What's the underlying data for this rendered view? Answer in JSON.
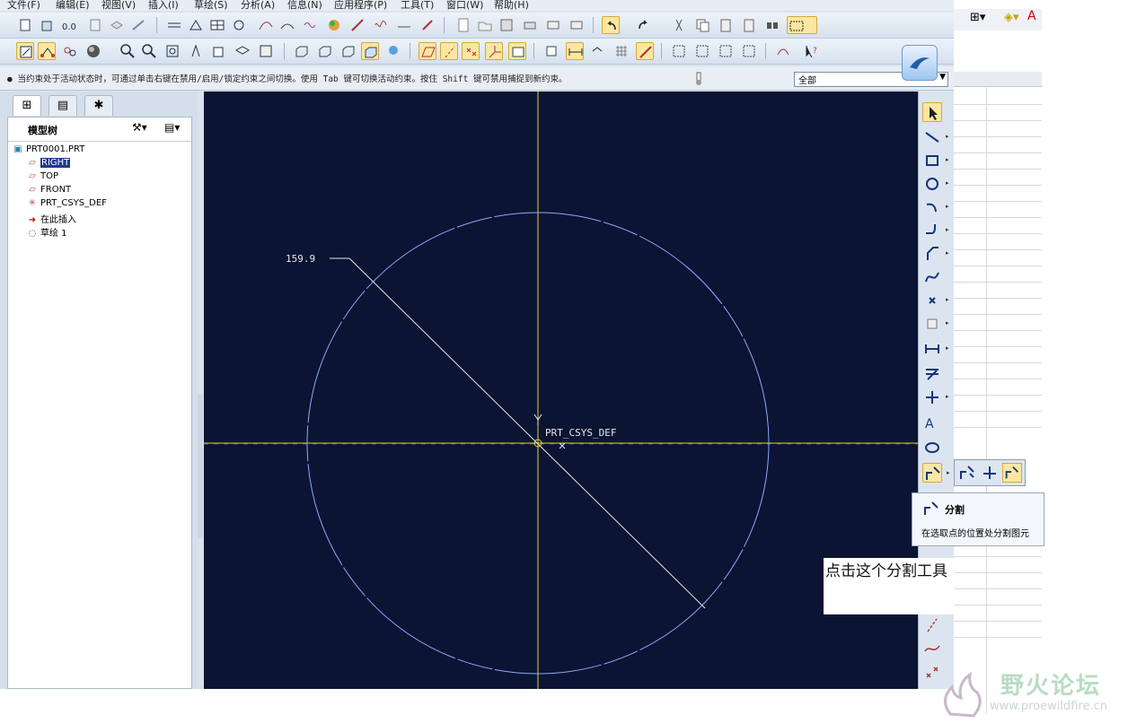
{
  "menu": [
    "文件(F)",
    "编辑(E)",
    "视图(V)",
    "插入(I)",
    "草绘(S)",
    "分析(A)",
    "信息(N)",
    "应用程序(P)",
    "工具(T)",
    "窗口(W)",
    "帮助(H)"
  ],
  "status_message": "● 当约束处于活动状态时，可通过单击右键在禁用/启用/锁定约束之间切换。使用 Tab 键可切换活动约束。按住 Shift 键可禁用捕捉到新约束。",
  "filter": {
    "value": "全部"
  },
  "model_tree": {
    "title": "模型树",
    "items": [
      {
        "label": "PRT0001.PRT",
        "icon": "part-icon"
      },
      {
        "label": "RIGHT",
        "icon": "datum-plane-icon",
        "selected": true
      },
      {
        "label": "TOP",
        "icon": "datum-plane-icon"
      },
      {
        "label": "FRONT",
        "icon": "datum-plane-icon"
      },
      {
        "label": "PRT_CSYS_DEF",
        "icon": "csys-icon"
      },
      {
        "label": "在此插入",
        "icon": "insert-arrow-icon"
      },
      {
        "label": "草绘 1",
        "icon": "sketch-icon"
      }
    ]
  },
  "canvas": {
    "dimension_label": "159.9",
    "csys_label": "PRT_CSYS_DEF",
    "axis_x_label": "X",
    "axis_y_label": "Y"
  },
  "tooltip": {
    "title": "分割",
    "description": "在选取点的位置处分割图元"
  },
  "annotation": "点击这个分割工具",
  "watermark": {
    "text": "野火论坛",
    "url": "www.proewildfire.cn"
  },
  "colors": {
    "canvas_bg": "#0b1432",
    "sketch": "#8fa6ff",
    "axis": "#e3d23a",
    "active_tool": "#fbe7a1"
  }
}
